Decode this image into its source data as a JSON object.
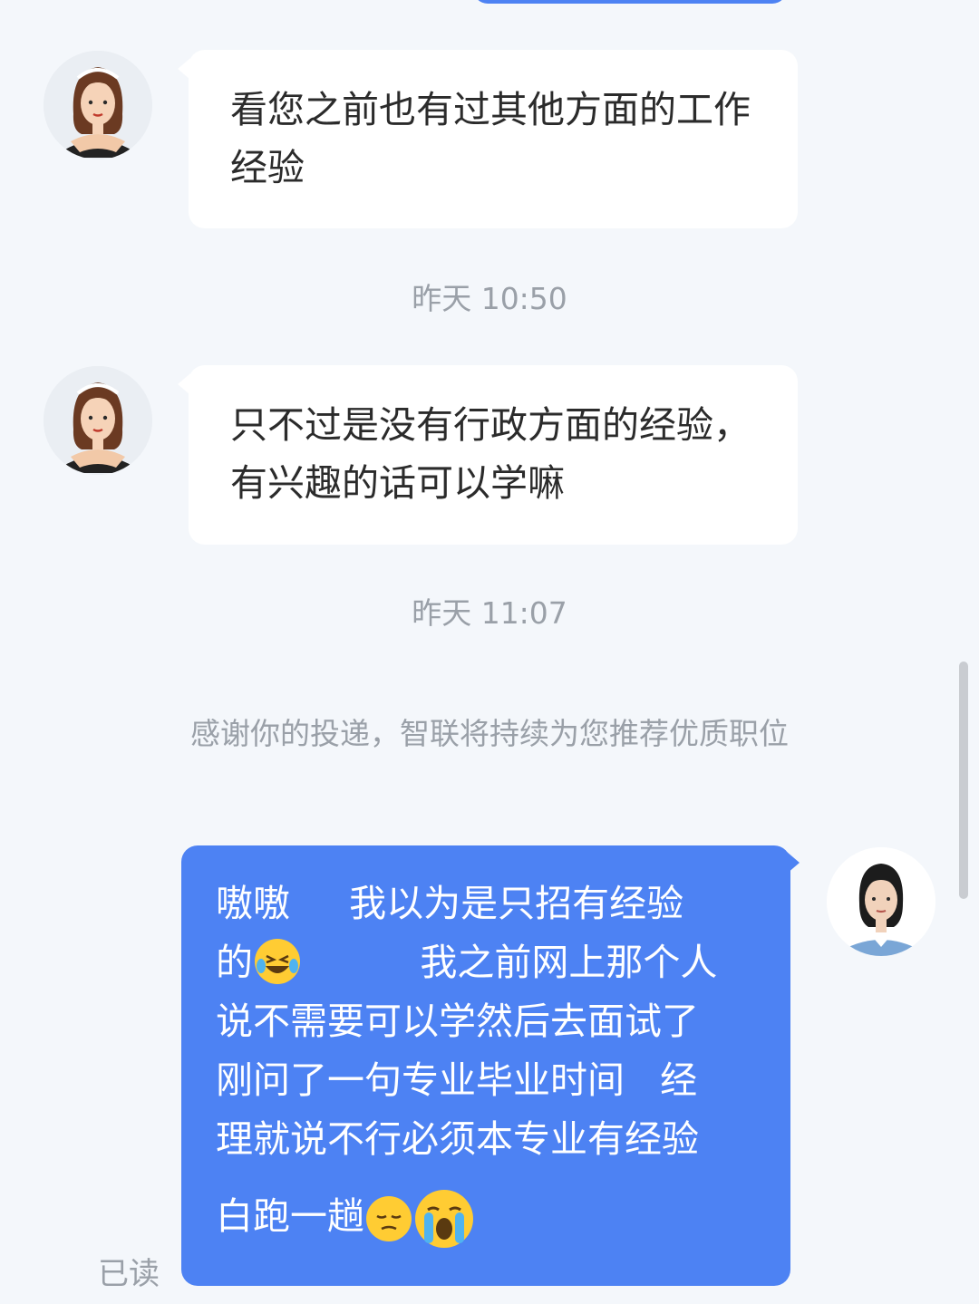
{
  "colors": {
    "background": "#f4f7fb",
    "incoming_bubble": "#ffffff",
    "outgoing_bubble": "#4d82f3",
    "muted_text": "#9aa0a8"
  },
  "messages": [
    {
      "sender": "recruiter",
      "avatar": "recruiter-avatar-icon",
      "text": "看您之前也有过其他方面的工作经验"
    },
    {
      "timestamp": "昨天 10:50"
    },
    {
      "sender": "recruiter",
      "avatar": "recruiter-avatar-icon",
      "text": "只不过是没有行政方面的经验，有兴趣的话可以学嘛"
    },
    {
      "timestamp": "昨天 11:07"
    },
    {
      "system": "感谢你的投递，智联将持续为您推荐优质职位"
    }
  ],
  "outgoing": {
    "avatar": "user-avatar-icon",
    "lines": [
      "嗷嗷     我以为是只招有经验",
      "的",
      "          我之前网上那个人",
      "说不需要可以学然后去面试了",
      "刚问了一句专业毕业时间   经",
      "理就说不行必须本专业有经验",
      "白跑一趟"
    ],
    "emojis": [
      "laughing-tears-emoji",
      "pensive-emoji",
      "crying-emoji"
    ],
    "status": "已读"
  }
}
